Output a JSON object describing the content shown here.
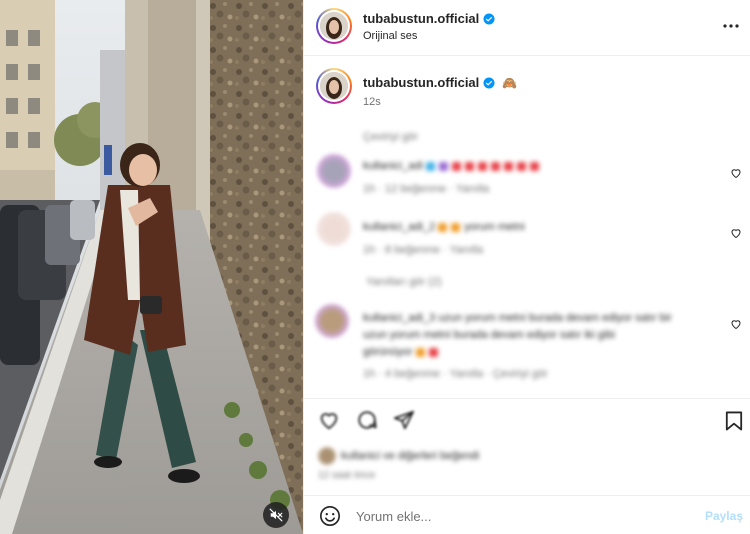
{
  "post": {
    "username": "tubabustun.official",
    "audio": "Orijinal ses",
    "caption_username": "tubabustun.official",
    "caption_emoji": "🙈",
    "caption_time": "12s"
  },
  "comments": {
    "translation_link": "Çeviriyi gör",
    "items": [
      {
        "user": "kullanici_adi",
        "text": "■ ■ ■ ■ ■ ■ ■",
        "meta": "1h · 12 beğenme · Yanıtla",
        "avatar_color": "#c9a8d8"
      },
      {
        "user": "kullanici_adi_2",
        "text": "yorum metni",
        "meta": "1h · 8 beğenme · Yanıtla",
        "avatar_color": "#e8d5d0"
      },
      {
        "user": "kullanici_adi_3",
        "text": "uzun yorum metni burada devam ediyor satır bir",
        "text2": "uzun yorum metni burada devam ediyor satır iki gibi",
        "text3": "görünüyor",
        "meta": "1h · 4 beğenme · Yanıtla · Çeviriyi gör",
        "avatar_color": "#b8a0c8"
      }
    ],
    "replies_link": "Yanıtları gör (2)"
  },
  "likes": {
    "text": "kullanici ve diğerleri beğendi",
    "date": "12 saat önce"
  },
  "comment_box": {
    "placeholder": "Yorum ekle...",
    "post_label": "Paylaş"
  },
  "colors": {
    "verified": "#0095f6",
    "post_button_disabled": "#b2dffc",
    "text_primary": "#262626",
    "text_secondary": "#737373"
  },
  "icons": {
    "more": "more-horizontal-icon",
    "verified": "verified-badge-icon",
    "heart": "heart-outline-icon",
    "comment": "comment-icon",
    "share": "share-icon",
    "save": "bookmark-icon",
    "emoji": "emoji-smile-icon",
    "mute": "muted-speaker-icon"
  }
}
